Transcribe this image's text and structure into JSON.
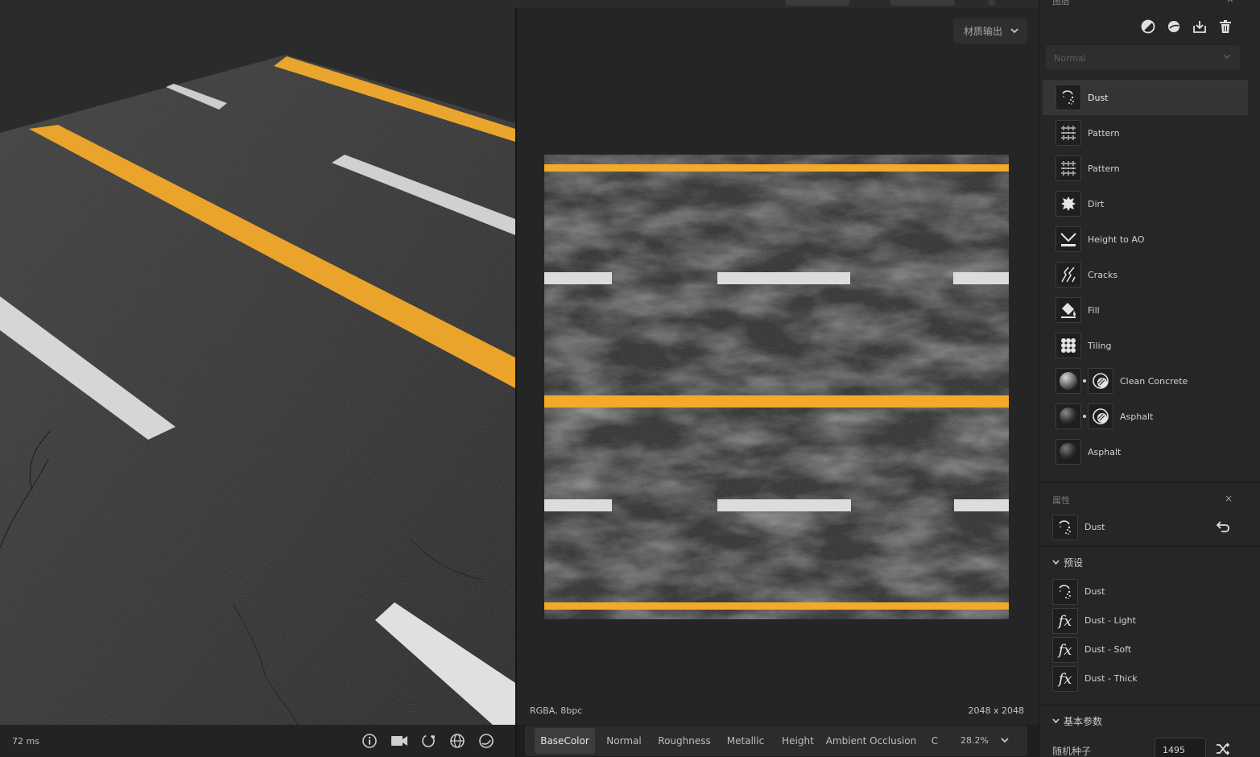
{
  "viewport3d": {
    "render_time": "72 ms",
    "tools": [
      "info-icon",
      "camera-icon",
      "light-rotate-icon",
      "environment-icon",
      "material-sphere-icon"
    ]
  },
  "viewport2d": {
    "output_select": "材质输出",
    "format": "RGBA, 8bpc",
    "size": "2048 x 2048",
    "zoom": "28.2%",
    "channels": [
      "BaseColor",
      "Normal",
      "Roughness",
      "Metallic",
      "Height",
      "Ambient Occlusion",
      "C"
    ],
    "active_channel": "BaseColor"
  },
  "layers": {
    "title": "图层",
    "close": "×",
    "blend_mode": "Normal",
    "items": [
      {
        "label": "Dust",
        "icon": "dust-icon",
        "selected": true
      },
      {
        "label": "Pattern",
        "icon": "pattern-icon"
      },
      {
        "label": "Pattern",
        "icon": "pattern-icon"
      },
      {
        "label": "Dirt",
        "icon": "dirt-icon"
      },
      {
        "label": "Height to AO",
        "icon": "height-to-ao-icon"
      },
      {
        "label": "Cracks",
        "icon": "cracks-icon"
      },
      {
        "label": "Fill",
        "icon": "fill-bucket-icon"
      },
      {
        "label": "Tiling",
        "icon": "tiling-icon"
      },
      {
        "label": "Clean Concrete",
        "icon": "material-sphere-icon",
        "masked": true
      },
      {
        "label": "Asphalt",
        "icon": "material-sphere-icon",
        "masked": true
      },
      {
        "label": "Asphalt",
        "icon": "material-sphere-icon"
      }
    ]
  },
  "properties": {
    "title": "属性",
    "close": "×",
    "layer_name": "Dust",
    "presets_header": "预设",
    "presets": [
      "Dust",
      "Dust - Light",
      "Dust - Soft",
      "Dust - Thick"
    ],
    "preset_fx": "fx",
    "basic_params_header": "基本参数",
    "seed_label": "随机种子",
    "seed_value": "1495"
  },
  "colors": {
    "asphalt": "#3a3a3a",
    "yellow_line": "#f0a82a",
    "white_line": "#d9d9d9",
    "panel_bg": "#262626"
  }
}
